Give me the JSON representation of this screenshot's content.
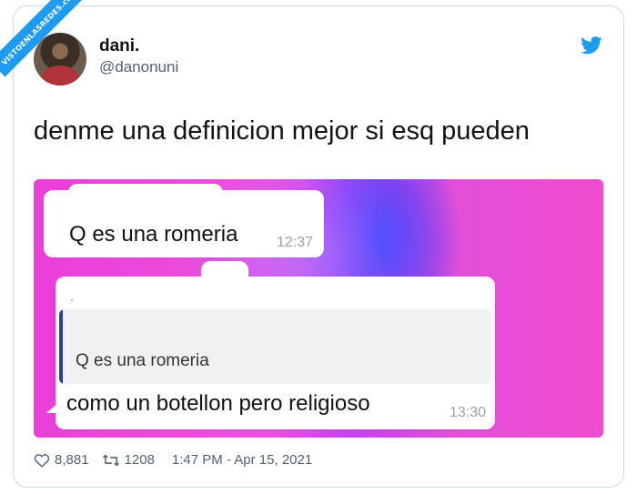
{
  "watermark": {
    "text": "VISTOENLASREDES.com"
  },
  "tweet": {
    "display_name": "dani.",
    "handle": "@danonuni",
    "text": "denme una definicion mejor si esq pueden",
    "likes": "8,881",
    "retweets": "1208",
    "timestamp": "1:47 PM - Apr 15, 2021"
  },
  "chat": {
    "message1": {
      "text": "Q es una romeria",
      "time": "12:37"
    },
    "message2": {
      "dot": ".",
      "quoted_text": "Q es una romeria",
      "text": "como un botellon pero religioso",
      "time": "13:30"
    }
  },
  "icons": {
    "brand": "twitter-bird-icon",
    "like": "heart-icon",
    "retweet": "retweet-icon"
  },
  "colors": {
    "twitter_blue": "#1d9bf0",
    "muted_text": "#536471",
    "quote_bar": "#2b3f9c",
    "chat_background": "#ea3fd8"
  }
}
